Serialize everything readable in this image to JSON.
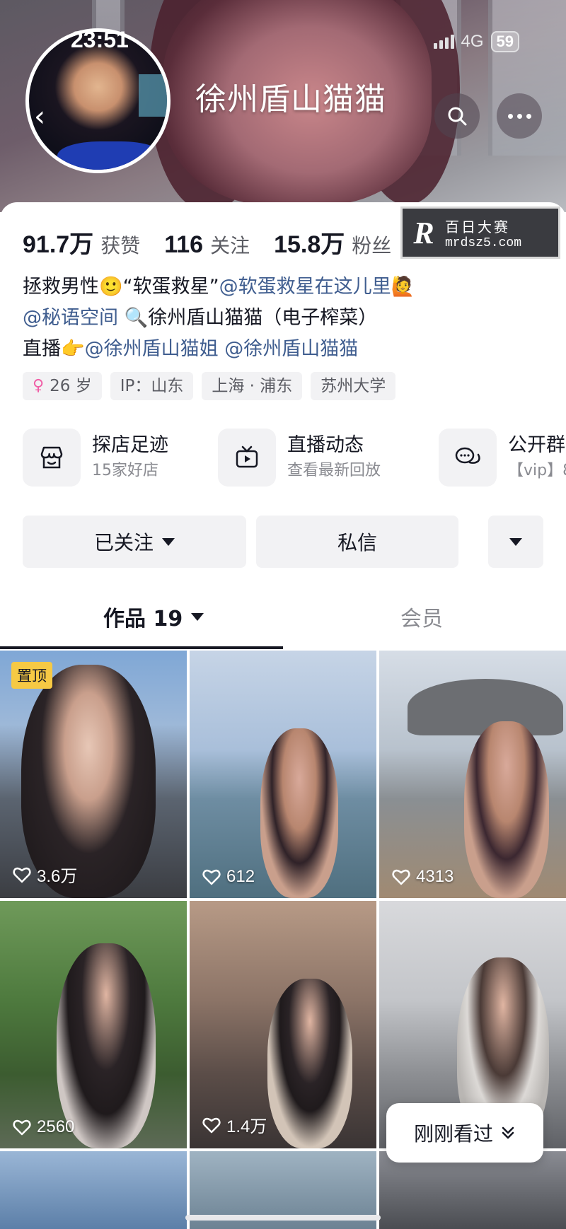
{
  "status": {
    "time": "23:51",
    "network": "4G",
    "battery": "59"
  },
  "header": {
    "title": "徐州盾山猫猫",
    "back": "‹"
  },
  "stats": [
    {
      "num": "91.7万",
      "label": "获赞"
    },
    {
      "num": "116",
      "label": "关注"
    },
    {
      "num": "15.8万",
      "label": "粉丝"
    }
  ],
  "watermark": {
    "logo": "R",
    "line1": "百日大赛",
    "line2": "mrdsz5.com"
  },
  "bio": {
    "line1_a": "拯救男性",
    "line1_emoji": "🙂",
    "line1_b": "“软蛋救星”",
    "line1_at": "@软蛋救星在这儿里",
    "line1_emoji2": "🙋",
    "line2_at": "@秘语空间",
    "line2_b": "🔍徐州盾山猫猫（电子榨菜）",
    "line3_a": "直播👉",
    "line3_at1": "@徐州盾山猫姐",
    "line3_at2": "@徐州盾山猫猫"
  },
  "tags": {
    "age_symbol": "♀",
    "age": "26 岁",
    "ip": "IP：山东",
    "location": "上海 · 浦东",
    "school": "苏州大学"
  },
  "shortcuts": [
    {
      "title": "探店足迹",
      "sub": "15家好店"
    },
    {
      "title": "直播动态",
      "sub": "查看最新回放"
    },
    {
      "title": "公开群",
      "sub": "【vip】8"
    }
  ],
  "actions": {
    "follow": "已关注",
    "message": "私信"
  },
  "tabs": {
    "works": "作品 19",
    "member": "会员"
  },
  "grid": [
    {
      "likes": "3.6万",
      "pinned": "置顶"
    },
    {
      "likes": "612"
    },
    {
      "likes": "4313"
    },
    {
      "likes": "2560"
    },
    {
      "likes": "1.4万"
    },
    {
      "likes": ""
    }
  ],
  "recent": {
    "label": "刚刚看过"
  },
  "colors": {
    "mention": "#3f5d8f",
    "pin": "#f6c944",
    "accent_text": "#161823"
  }
}
